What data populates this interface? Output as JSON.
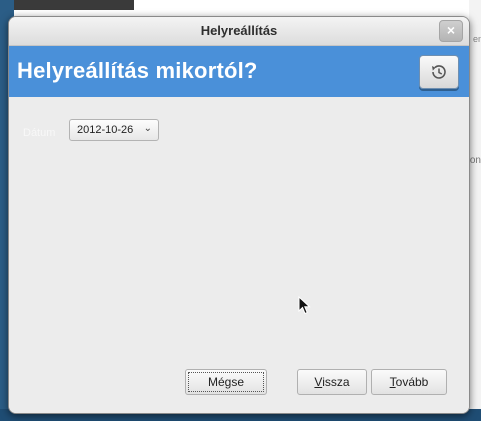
{
  "window": {
    "title": "Helyreállítás"
  },
  "header": {
    "heading": "Helyreállítás mikortól?"
  },
  "date": {
    "label": "Dátum",
    "value": "2012-10-26"
  },
  "buttons": {
    "cancel": "Mégse",
    "back_mnemonic": "V",
    "back_rest": "issza",
    "next_mnemonic": "T",
    "next_rest": "ovább"
  },
  "background": {
    "right_text_top": "en",
    "right_text_mid": "on"
  },
  "colors": {
    "header_blue": "#4a90d9",
    "dialog_bg": "#ececec"
  },
  "icons": [
    "close-icon",
    "history-icon",
    "chevron-down-icon",
    "mouse-pointer-icon"
  ]
}
